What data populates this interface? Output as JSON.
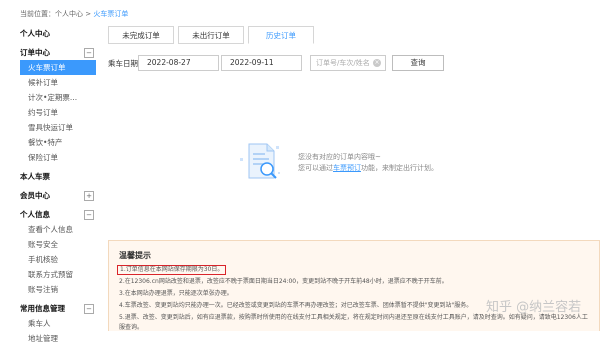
{
  "breadcrumb": {
    "prefix": "当前位置：",
    "home": "个人中心",
    "sep": " > ",
    "current": "火车票订单"
  },
  "sidebar": {
    "groups": [
      {
        "title": "个人中心",
        "toggle": "",
        "items": []
      },
      {
        "title": "订单中心",
        "toggle": "−",
        "items": [
          "火车票订单",
          "候补订单",
          "计次•定期票...",
          "约号订单",
          "雪具快运订单",
          "餐饮•特产",
          "保险订单"
        ]
      },
      {
        "title": "本人车票",
        "toggle": "",
        "items": []
      },
      {
        "title": "会员中心",
        "toggle": "+",
        "items": []
      },
      {
        "title": "个人信息",
        "toggle": "−",
        "items": [
          "查看个人信息",
          "账号安全",
          "手机核验",
          "联系方式预留",
          "账号注销"
        ]
      },
      {
        "title": "常用信息管理",
        "toggle": "−",
        "items": [
          "乘车人",
          "地址管理"
        ]
      }
    ],
    "active_item": "火车票订单"
  },
  "tabs": [
    "未完成订单",
    "未出行订单",
    "历史订单"
  ],
  "active_tab": "历史订单",
  "filters": {
    "label": "乘车日期",
    "date_from": "2022-08-27",
    "date_to": "2022-09-11",
    "dash": "-",
    "search_placeholder": "订单号/车次/姓名",
    "clear_symbol": "×",
    "query_button": "查询"
  },
  "empty_state": {
    "line1": "您没有对应的订单内容哦~",
    "line2_prefix": "您可以通过",
    "line2_link": "车票预订",
    "line2_suffix": "功能，来制定出行计划。"
  },
  "tips": {
    "title": "温馨提示",
    "items": [
      "1.订单信息在本网站保存期限为30日。",
      "2.在12306.cn网站改签和退票，改签应不晚于票面日期当日24:00，变更到站不晚于开车前48小时，退票应不晚于开车前。",
      "3.在本网站办理退票，只能逐次单张办理。",
      "4.车票改签、变更到站均只能办理一次。已经改签或变更到站的车票不再办理改签；对已改签车票、团体票暂不提供\"变更到站\"服务。",
      "5.退票、改签、变更到站后，如有应退票款，按购票时所使用的在线支付工具相关规定，将在规定时间内退还至原在线支付工具账户，请及时查询。如有疑问，请致电12306人工",
      "服查询。"
    ],
    "highlight_index": 0
  },
  "watermark": "知乎 @纳兰容若",
  "colors": {
    "accent": "#3b99fc",
    "highlight_border": "#d9242a",
    "tips_bg": "#fff7ef"
  }
}
